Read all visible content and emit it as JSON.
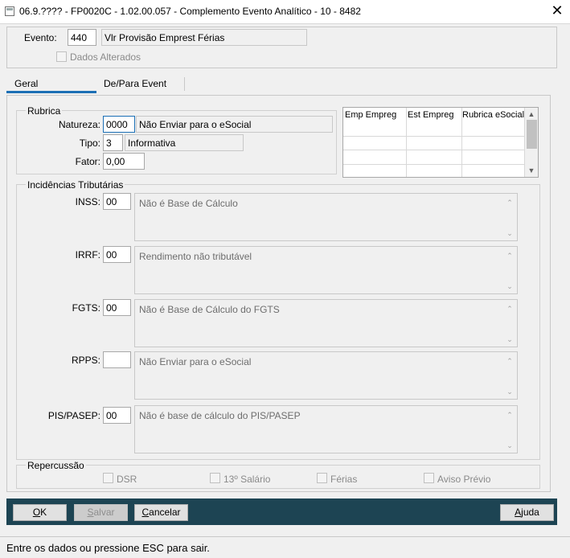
{
  "window": {
    "title": "06.9.???? - FP0020C - 1.02.00.057 - Complemento Evento Analítico - 10 - 8482",
    "close_glyph": "✕"
  },
  "header": {
    "evento_label": "Evento:",
    "evento_code": "440",
    "evento_desc": "Vlr Provisão Emprest Férias",
    "dados_alterados_label": "Dados Alterados"
  },
  "tabs": [
    {
      "label": "Geral",
      "active": true
    },
    {
      "label": "De/Para Event",
      "active": false
    }
  ],
  "rubrica": {
    "legend": "Rubrica",
    "natureza_label": "Natureza:",
    "natureza_code": "0000",
    "natureza_desc": "Não Enviar para o eSocial",
    "tipo_label": "Tipo:",
    "tipo_code": "3",
    "tipo_desc": "Informativa",
    "fator_label": "Fator:",
    "fator_value": "0,00"
  },
  "grid": {
    "columns": [
      "Emp Empreg",
      "Est Empreg",
      "Rubrica eSocial"
    ],
    "rows": [
      [
        "",
        "",
        ""
      ],
      [
        "",
        "",
        ""
      ],
      [
        "",
        "",
        ""
      ]
    ]
  },
  "incidencias": {
    "legend": "Incidências Tributárias",
    "items": [
      {
        "label": "INSS:",
        "code": "00",
        "desc": "Não é Base de Cálculo"
      },
      {
        "label": "IRRF:",
        "code": "00",
        "desc": "Rendimento não tributável"
      },
      {
        "label": "FGTS:",
        "code": "00",
        "desc": "Não é Base de Cálculo do FGTS"
      },
      {
        "label": "RPPS:",
        "code": "",
        "desc": "Não Enviar para o eSocial"
      },
      {
        "label": "PIS/PASEP:",
        "code": "00",
        "desc": "Não é base de cálculo do PIS/PASEP"
      }
    ]
  },
  "repercussao": {
    "legend": "Repercussão",
    "options": [
      {
        "label": "DSR",
        "checked": false
      },
      {
        "label": "13º Salário",
        "checked": false
      },
      {
        "label": "Férias",
        "checked": false
      },
      {
        "label": "Aviso Prévio",
        "checked": false
      }
    ]
  },
  "buttons": {
    "ok": "OK",
    "salvar": "Salvar",
    "cancelar": "Cancelar",
    "ajuda": "Ajuda"
  },
  "status": {
    "text": "Entre os dados ou pressione ESC para sair."
  },
  "colors": {
    "footer_bar": "#1d4453",
    "tab_accent": "#1b6fb5"
  }
}
